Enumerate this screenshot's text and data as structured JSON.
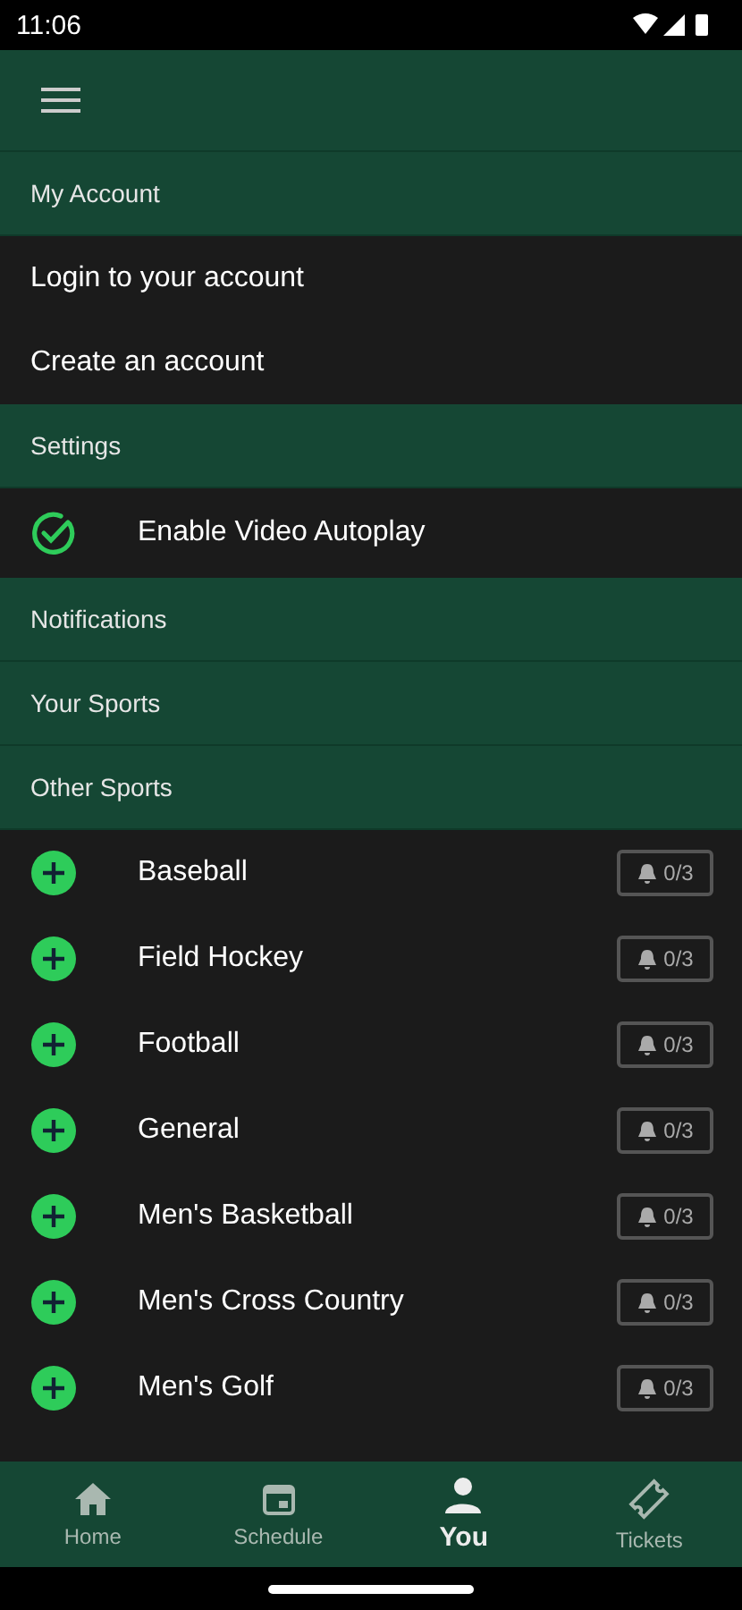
{
  "status_bar": {
    "time": "11:06"
  },
  "sections": [
    {
      "title": "My Account",
      "items": [
        {
          "kind": "link",
          "label": "Login to your account"
        },
        {
          "kind": "link",
          "label": "Create an account"
        }
      ]
    },
    {
      "title": "Settings",
      "items": [
        {
          "kind": "toggle",
          "label": "Enable Video Autoplay",
          "checked": true
        }
      ]
    },
    {
      "title": "Notifications"
    },
    {
      "title": "Your Sports"
    },
    {
      "title": "Other Sports",
      "items": [
        {
          "kind": "sport",
          "label": "Baseball",
          "alerts": "0/3"
        },
        {
          "kind": "sport",
          "label": "Field Hockey",
          "alerts": "0/3"
        },
        {
          "kind": "sport",
          "label": "Football",
          "alerts": "0/3"
        },
        {
          "kind": "sport",
          "label": "General",
          "alerts": "0/3"
        },
        {
          "kind": "sport",
          "label": "Men's Basketball",
          "alerts": "0/3"
        },
        {
          "kind": "sport",
          "label": "Men's Cross Country",
          "alerts": "0/3"
        },
        {
          "kind": "sport",
          "label": "Men's Golf",
          "alerts": "0/3"
        }
      ]
    }
  ],
  "bottom_nav": [
    {
      "label": "Home",
      "selected": false
    },
    {
      "label": "Schedule",
      "selected": false
    },
    {
      "label": "You",
      "selected": true
    },
    {
      "label": "Tickets",
      "selected": false
    }
  ]
}
